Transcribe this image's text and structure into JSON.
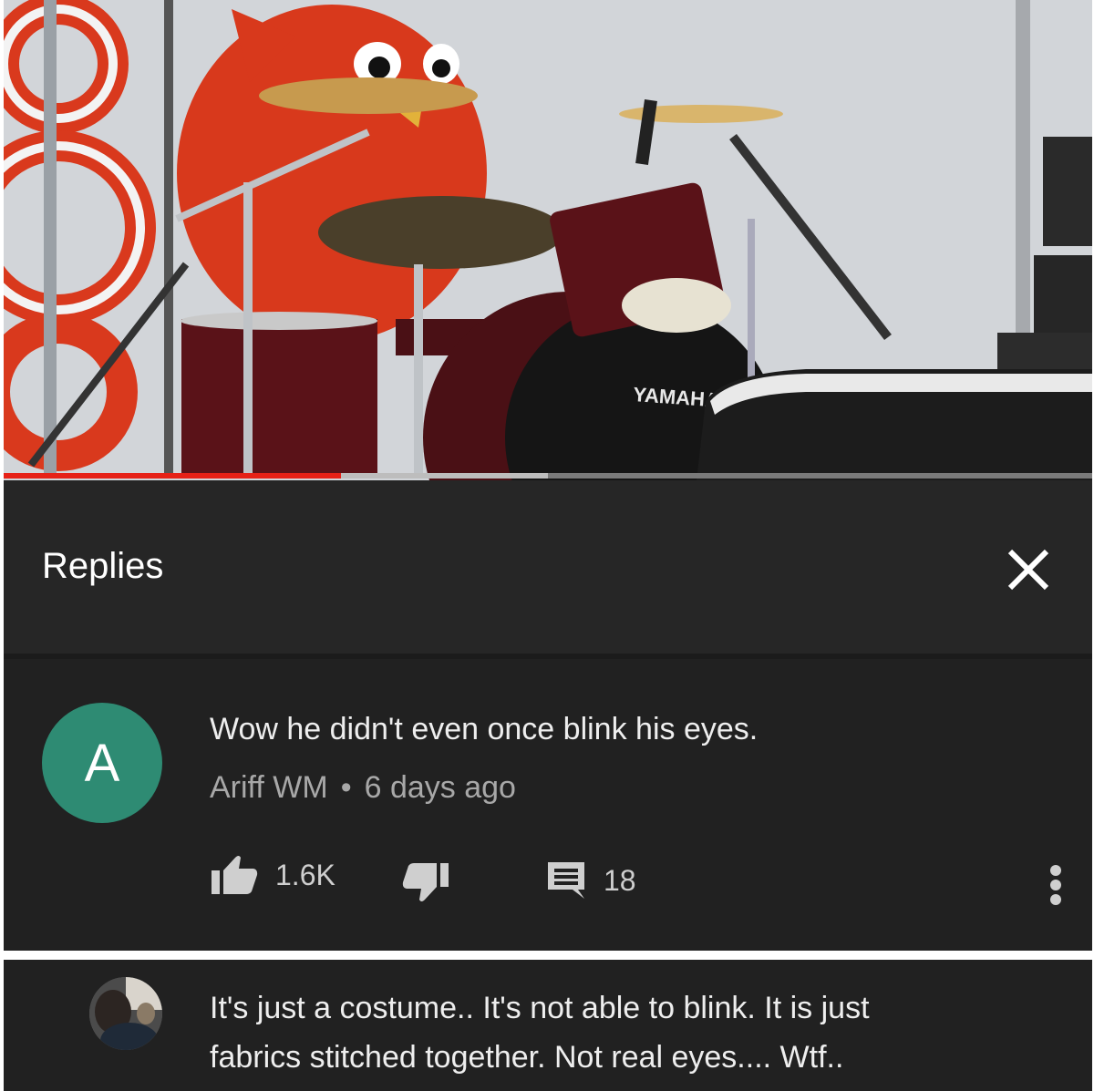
{
  "video": {
    "watermark_text": "YAMAHA",
    "progress": {
      "played_fraction": 0.31,
      "buffered_fraction": 0.5
    },
    "colors": {
      "progress_played": "#e62117",
      "mascot": "#d8391c",
      "drum_shell": "#5a1218"
    }
  },
  "replies_panel": {
    "title": "Replies",
    "close_icon": "close-icon"
  },
  "comment": {
    "avatar_letter": "A",
    "avatar_color": "#2e8b73",
    "text": "Wow he didn't even once blink his eyes.",
    "author": "Ariff WM",
    "separator": "•",
    "time": "6 days ago",
    "likes": "1.6K",
    "replies_count": "18",
    "icons": [
      "thumb-up-icon",
      "thumb-down-icon",
      "reply-icon",
      "more-vert-icon"
    ]
  },
  "reply": {
    "line1": "It's just a costume.. It's not able to blink. It is just",
    "line2": "fabrics stitched together.  Not real eyes.... Wtf.."
  }
}
